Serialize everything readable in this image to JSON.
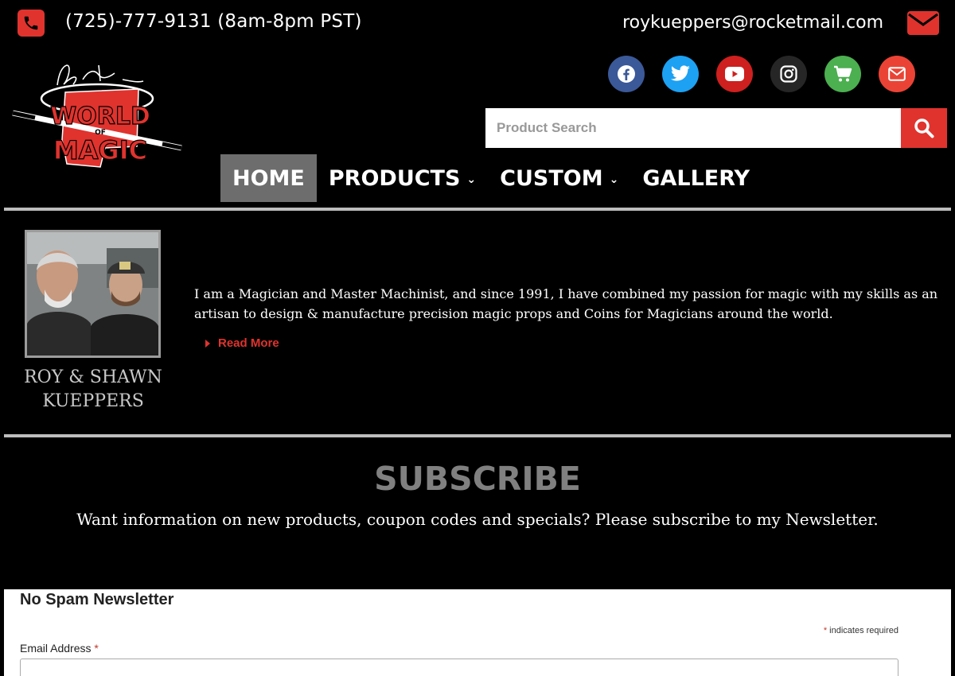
{
  "topbar": {
    "phone": "(725)-777-9131 (8am-8pm PST)",
    "email": "roykueppers@rocketmail.com",
    "phone_icon": "phone-icon",
    "mail_icon": "envelope-icon"
  },
  "logo": {
    "lines": [
      "WORLD",
      "MAGIC"
    ],
    "small": "OF"
  },
  "social": [
    {
      "name": "facebook-icon",
      "color": "#3b5998"
    },
    {
      "name": "twitter-icon",
      "color": "#1da1f2"
    },
    {
      "name": "youtube-icon",
      "color": "#cd201f"
    },
    {
      "name": "instagram-icon",
      "color": "#262626"
    },
    {
      "name": "cart-icon",
      "color": "#4caf50"
    },
    {
      "name": "envelope-icon",
      "color": "#ea4335"
    }
  ],
  "search": {
    "placeholder": "Product Search",
    "button_icon": "search-icon"
  },
  "nav": {
    "items": [
      {
        "label": "HOME",
        "active": true
      },
      {
        "label": "PRODUCTS",
        "dropdown": true
      },
      {
        "label": "CUSTOM",
        "dropdown": true
      },
      {
        "label": "GALLERY"
      }
    ]
  },
  "about": {
    "names": "ROY & SHAWN KUEPPERS",
    "text": "I am a Magician and Master Machinist, and since 1991, I have combined my passion for magic with my skills as an artisan to design & manufacture precision magic props and Coins for Magicians around the world.",
    "read_more": "Read More"
  },
  "subscribe": {
    "title": "SUBSCRIBE",
    "text": "Want information on new products, coupon codes and specials? Please subscribe to my Newsletter."
  },
  "newsletter": {
    "title": "No Spam Newsletter",
    "required_note": "indicates required",
    "email_label": "Email Address",
    "asterisk": "*"
  },
  "colors": {
    "accent": "#e0332e",
    "background": "#000000",
    "nav_active": "#6d6d6d",
    "rule": "#bdbdbd",
    "subscribe_title": "#808080"
  }
}
